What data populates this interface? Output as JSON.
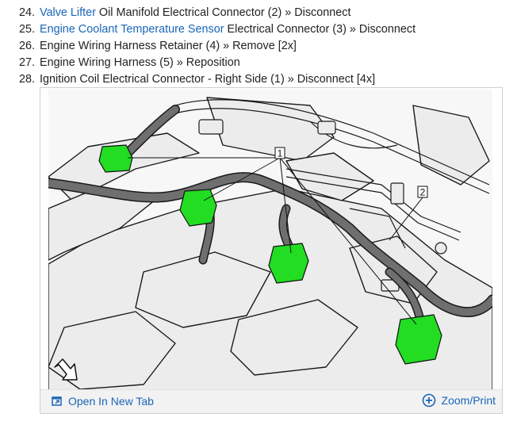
{
  "steps": [
    {
      "num": "24.",
      "link": "Valve Lifter",
      "text": " Oil Manifold Electrical Connector (2) » Disconnect"
    },
    {
      "num": "25.",
      "link": "Engine Coolant Temperature Sensor",
      "text": " Electrical Connector (3) » Disconnect"
    },
    {
      "num": "26.",
      "link": "",
      "text": "Engine Wiring Harness Retainer (4) » Remove [2x]"
    },
    {
      "num": "27.",
      "link": "",
      "text": "Engine Wiring Harness (5) » Reposition"
    },
    {
      "num": "28.",
      "link": "",
      "text": "Ignition Coil Electrical Connector - Right Side (1) » Disconnect [4x]"
    }
  ],
  "figure": {
    "callouts": [
      "1",
      "2"
    ],
    "open_tab_label": "Open In New Tab",
    "zoom_label": "Zoom/Print",
    "icons": {
      "open_tab": "open-new-tab-icon",
      "zoom": "zoom-plus-icon",
      "front": "front-direction-arrow-icon"
    },
    "colors": {
      "link": "#1a66b8",
      "highlight": "#22dd22",
      "line": "#111111"
    }
  }
}
